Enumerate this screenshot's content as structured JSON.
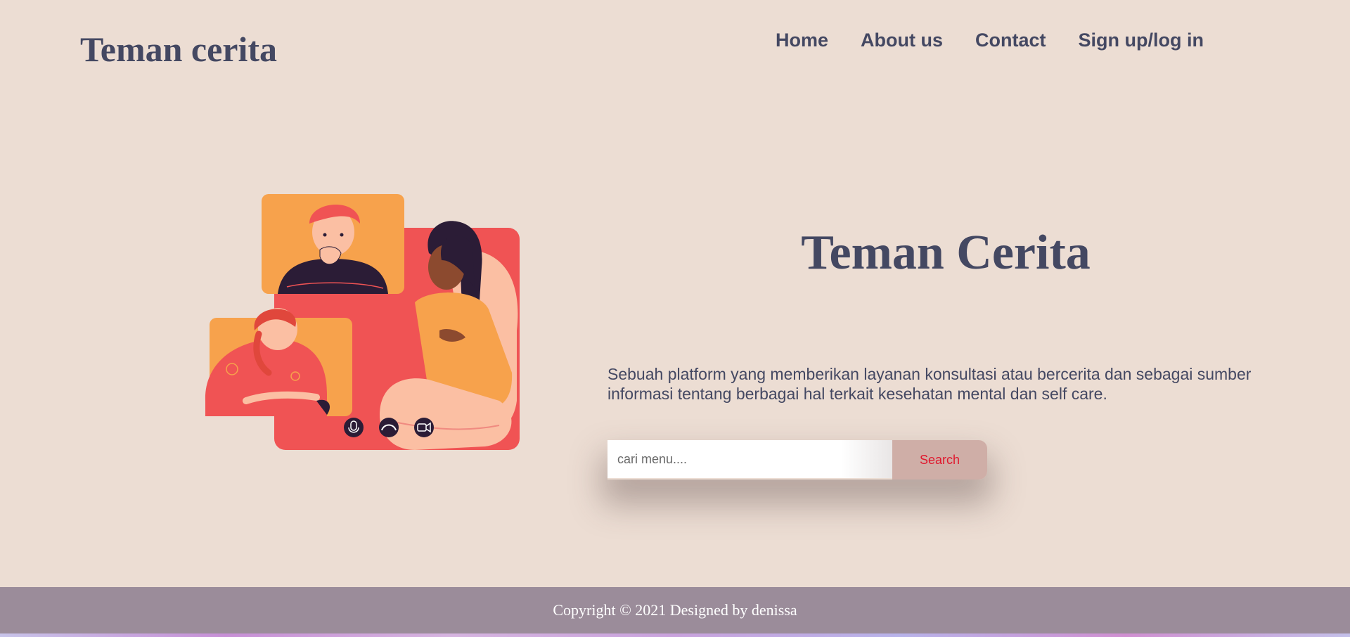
{
  "header": {
    "brand": "Teman cerita",
    "nav": [
      {
        "label": "Home"
      },
      {
        "label": "About us"
      },
      {
        "label": "Contact"
      },
      {
        "label": "Sign up/log in"
      }
    ]
  },
  "hero": {
    "title": "Teman Cerita",
    "description": "Sebuah platform yang memberikan layanan konsultasi atau bercerita dan sebagai sumber informasi tentang berbagai hal terkait kesehatan mental dan self care.",
    "illustration": {
      "icons": [
        "microphone-icon",
        "hang-up-phone-icon",
        "video-camera-icon"
      ],
      "colors": {
        "orange": "#f7a24c",
        "coral": "#f05354",
        "skin": "#fbbfa3",
        "dark": "#2b1c36"
      }
    }
  },
  "search": {
    "placeholder": "cari menu....",
    "button_label": "Search"
  },
  "footer": {
    "copyright": "Copyright © 2021 Designed by denissa"
  },
  "colors": {
    "background": "#ecddd3",
    "heading": "#444862",
    "footer": "#9b8c9a",
    "search_button": "#cfaea7",
    "search_button_text": "#e0192e"
  }
}
